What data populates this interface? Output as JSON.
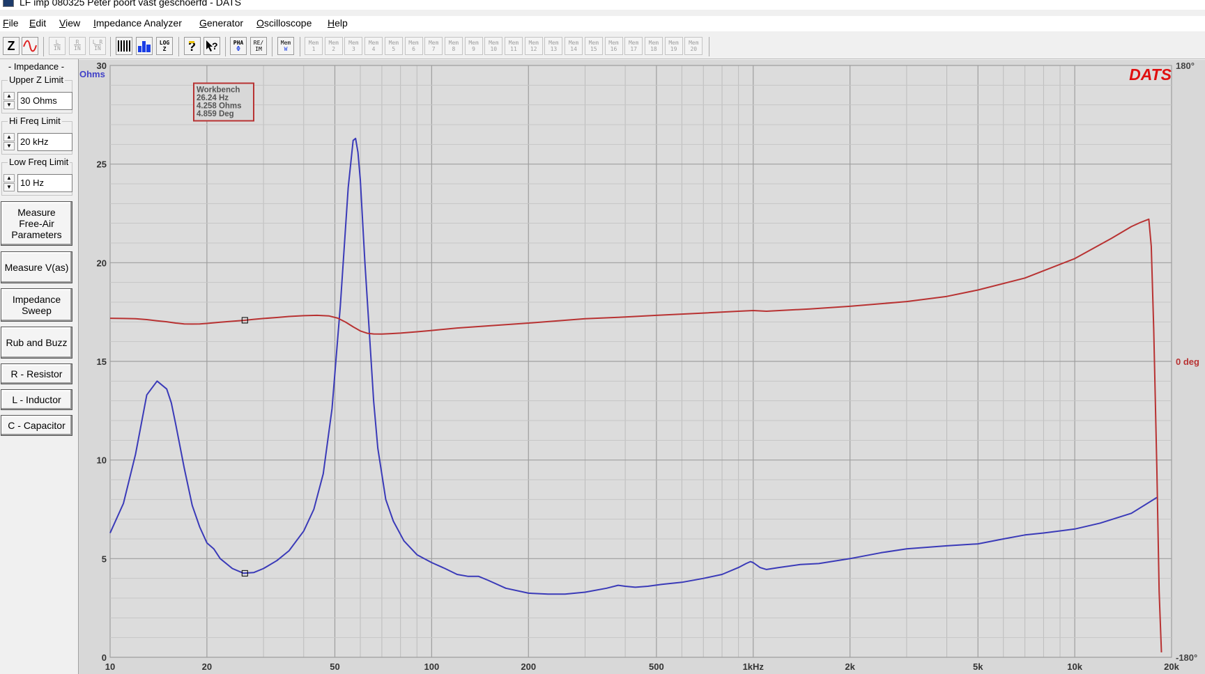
{
  "window": {
    "title": "LF imp 080325 Peter poort vast geschoerfd - DATS"
  },
  "menu": [
    {
      "key": "F",
      "rest": "ile"
    },
    {
      "key": "E",
      "rest": "dit"
    },
    {
      "key": "V",
      "rest": "iew"
    },
    {
      "key": "I",
      "rest": "mpedance Analyzer"
    },
    {
      "key": "G",
      "rest": "enerator"
    },
    {
      "key": "O",
      "rest": "scilloscope"
    },
    {
      "key": "H",
      "rest": "elp"
    }
  ],
  "toolbar": {
    "z_label": "Z",
    "input_buttons": [
      {
        "top": "L",
        "bottom": "IN"
      },
      {
        "top": "R",
        "bottom": "IN"
      },
      {
        "top": "L R",
        "bottom": "IN"
      }
    ],
    "log_label": "LOG",
    "log_sub": "Z",
    "pha_label": "PHA",
    "pha_sub": "Φ",
    "reim_label": "RE/",
    "reim_sub": "IM",
    "memw_label": "Mem",
    "memw_sub": "W",
    "mem_label": "Mem",
    "mem_slots": [
      "1",
      "2",
      "3",
      "4",
      "5",
      "6",
      "7",
      "8",
      "9",
      "10",
      "11",
      "12",
      "13",
      "14",
      "15",
      "16",
      "17",
      "18",
      "19",
      "20"
    ]
  },
  "panel": {
    "section_title": "- Impedance -",
    "upper_z": {
      "label": "Upper Z Limit",
      "value": "30 Ohms"
    },
    "hi_freq": {
      "label": "Hi Freq Limit",
      "value": "20 kHz"
    },
    "low_freq": {
      "label": "Low Freq Limit",
      "value": "10 Hz"
    },
    "buttons": {
      "free_air": "Measure\nFree-Air\nParameters",
      "vas": "Measure V(as)",
      "sweep": "Impedance\nSweep",
      "rub": "Rub and Buzz",
      "resistor": "R - Resistor",
      "inductor": "L - Inductor",
      "capacitor": "C - Capacitor"
    }
  },
  "chart_data": {
    "type": "line",
    "x_scale": "log",
    "xlim": [
      10,
      20000
    ],
    "ylim": [
      0,
      30
    ],
    "y2lim": [
      -180,
      180
    ],
    "ylabel": "Ohms",
    "brand": "DATS",
    "grid": true,
    "x_ticks": [
      {
        "value": 10,
        "label": "10"
      },
      {
        "value": 20,
        "label": "20"
      },
      {
        "value": 50,
        "label": "50"
      },
      {
        "value": 100,
        "label": "100"
      },
      {
        "value": 200,
        "label": "200"
      },
      {
        "value": 500,
        "label": "500"
      },
      {
        "value": 1000,
        "label": "1kHz"
      },
      {
        "value": 2000,
        "label": "2k"
      },
      {
        "value": 5000,
        "label": "5k"
      },
      {
        "value": 10000,
        "label": "10k"
      },
      {
        "value": 20000,
        "label": "20k"
      }
    ],
    "y_ticks": [
      {
        "value": 0,
        "label": "0"
      },
      {
        "value": 5,
        "label": "5"
      },
      {
        "value": 10,
        "label": "10"
      },
      {
        "value": 15,
        "label": "15"
      },
      {
        "value": 20,
        "label": "20"
      },
      {
        "value": 25,
        "label": "25"
      },
      {
        "value": 30,
        "label": "30"
      }
    ],
    "y2_ticks": [
      {
        "value": 180,
        "label": "180°"
      },
      {
        "value": 0,
        "label": "0 deg"
      },
      {
        "value": -180,
        "label": "-180°"
      }
    ],
    "series": [
      {
        "color": "#3a3ab8",
        "axis": "left",
        "x": [
          10,
          11,
          12,
          13,
          14,
          15,
          15.5,
          16,
          17,
          18,
          19,
          20,
          21,
          22,
          24,
          26,
          28,
          30,
          33,
          36,
          40,
          43,
          46,
          49,
          52,
          55,
          57,
          58,
          59,
          60,
          62,
          64,
          66,
          68,
          72,
          76,
          82,
          90,
          100,
          110,
          120,
          130,
          140,
          150,
          170,
          200,
          230,
          260,
          300,
          350,
          380,
          400,
          430,
          470,
          520,
          600,
          700,
          800,
          900,
          950,
          980,
          1000,
          1050,
          1100,
          1200,
          1400,
          1600,
          2000,
          2500,
          3000,
          4000,
          5000,
          6000,
          7000,
          8000,
          10000,
          12000,
          15000,
          18000
        ],
        "y": [
          6.3,
          7.8,
          10.3,
          13.3,
          14.0,
          13.6,
          12.9,
          11.8,
          9.6,
          7.7,
          6.6,
          5.8,
          5.5,
          5.0,
          4.5,
          4.26,
          4.3,
          4.5,
          4.9,
          5.4,
          6.4,
          7.5,
          9.3,
          12.6,
          17.8,
          23.8,
          26.2,
          26.3,
          25.6,
          24.2,
          20.0,
          16.5,
          13.0,
          10.6,
          8.0,
          6.9,
          5.9,
          5.2,
          4.8,
          4.5,
          4.2,
          4.1,
          4.1,
          3.9,
          3.5,
          3.25,
          3.2,
          3.2,
          3.3,
          3.5,
          3.65,
          3.6,
          3.55,
          3.6,
          3.7,
          3.8,
          4.0,
          4.2,
          4.55,
          4.75,
          4.85,
          4.8,
          4.55,
          4.45,
          4.55,
          4.7,
          4.75,
          5.0,
          5.3,
          5.5,
          5.65,
          5.75,
          6.0,
          6.2,
          6.3,
          6.5,
          6.8,
          7.3,
          8.1
        ]
      },
      {
        "color": "#b83232",
        "axis": "right",
        "x": [
          10,
          11,
          12,
          13,
          14,
          15,
          16,
          17,
          18,
          19,
          20,
          22,
          24,
          26.24,
          28,
          30,
          33,
          36,
          40,
          44,
          48,
          51,
          54,
          57,
          60,
          63,
          66,
          70,
          74,
          80,
          90,
          100,
          120,
          150,
          200,
          300,
          400,
          500,
          700,
          900,
          1000,
          1100,
          1500,
          2000,
          3000,
          4000,
          5000,
          7000,
          10000,
          13000,
          15000,
          16000,
          17000,
          17300,
          17600,
          18000,
          18300,
          18600
        ],
        "y": [
          26.2,
          26.1,
          25.9,
          25.4,
          24.7,
          24.1,
          23.3,
          22.8,
          22.7,
          22.8,
          23.1,
          23.8,
          24.4,
          25.0,
          25.6,
          26.1,
          26.7,
          27.3,
          27.8,
          28.0,
          27.6,
          26.3,
          23.9,
          21.0,
          18.5,
          17.1,
          16.7,
          16.6,
          16.8,
          17.2,
          18.0,
          18.8,
          20.3,
          21.6,
          23.3,
          25.9,
          27.0,
          28.0,
          29.4,
          30.5,
          30.9,
          30.5,
          31.9,
          33.5,
          36.4,
          39.5,
          43.4,
          50.7,
          62.5,
          74.8,
          82.0,
          84.5,
          86.5,
          70.0,
          20.0,
          -65.0,
          -140.0,
          -177.0
        ]
      }
    ],
    "markers": [
      {
        "series": 0,
        "x": 26.24,
        "y": 4.258
      },
      {
        "series": 1,
        "x": 26.24,
        "y": 25.0
      }
    ],
    "info_box": {
      "lines": [
        "Workbench",
        "26.24 Hz",
        "4.258 Ohms",
        "4.859 Deg"
      ]
    }
  }
}
